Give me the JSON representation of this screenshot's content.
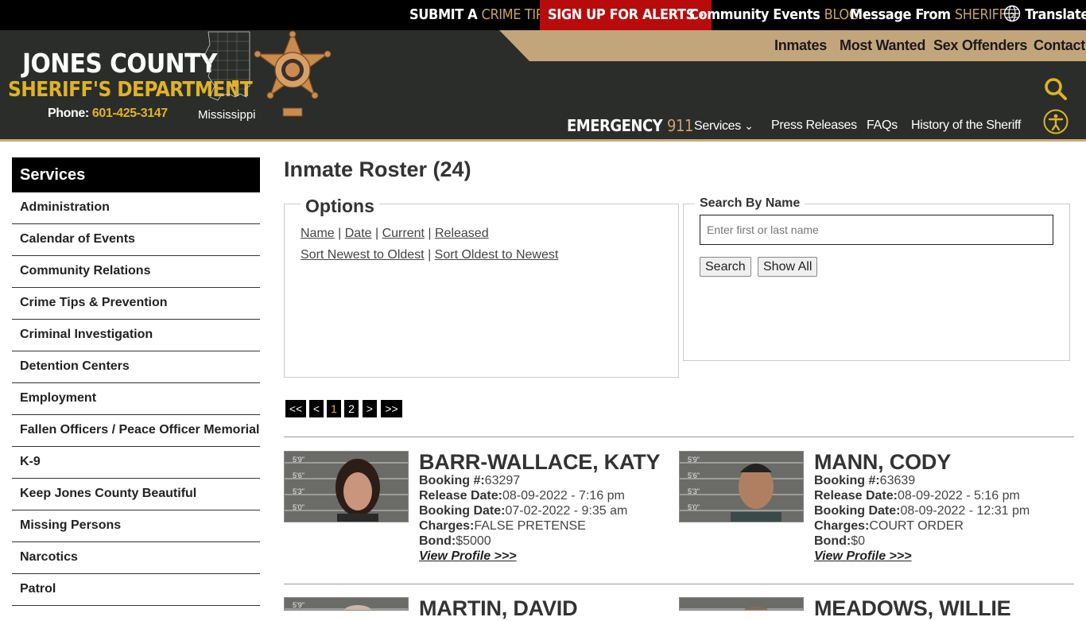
{
  "topbar": {
    "crime_tip": {
      "pre": "SUBMIT A ",
      "hl": "CRIME TIP",
      "chev": "›"
    },
    "alerts": {
      "label": "SIGN UP FOR ALERTS",
      "chev": "›"
    },
    "blog": {
      "pre": "Community Events ",
      "hl": "BLOG",
      "chev": "›"
    },
    "sheriff_msg": {
      "pre": "Message From ",
      "hl": "SHERIFF",
      "chev": "›"
    },
    "translate": "Translate"
  },
  "header": {
    "line1": "JONES COUNTY",
    "line2": "SHERIFF'S DEPARTMENT",
    "phone_label": "Phone: ",
    "phone": "601-425-3147",
    "state": "Mississippi",
    "util_links": [
      "Inmates",
      "Most Wanted",
      "Sex Offenders",
      "Contact"
    ],
    "emergency_label": "EMERGENCY",
    "emergency_num": "911",
    "nav": [
      "Services",
      "Press Releases",
      "FAQs",
      "History of the Sheriff"
    ],
    "nav_caret": "⌄"
  },
  "sidebar": {
    "title": "Services",
    "items": [
      "Administration",
      "Calendar of Events",
      "Community Relations",
      "Crime Tips & Prevention",
      "Criminal Investigation",
      "Detention Centers",
      "Employment",
      "Fallen Officers / Peace Officer Memorial",
      "K-9",
      "Keep Jones County Beautiful",
      "Missing Persons",
      "Narcotics",
      "Patrol"
    ]
  },
  "main": {
    "title": "Inmate Roster (24)",
    "options": {
      "legend": "Options",
      "sort_links": [
        "Name",
        "Date",
        "Current",
        "Released"
      ],
      "order_links": [
        "Sort Newest to Oldest",
        "Sort Oldest to Newest"
      ],
      "sep": " | "
    },
    "search": {
      "legend": "Search By Name",
      "placeholder": "Enter first or last name",
      "search_btn": "Search",
      "show_all_btn": "Show All"
    },
    "pager": [
      "<<",
      "<",
      "1",
      "2",
      ">",
      ">>"
    ],
    "current_page": "1"
  },
  "labels": {
    "booking_no": "Booking #:",
    "release_date": "Release Date:",
    "booking_date": "Booking Date:",
    "charges": "Charges:",
    "bond": "Bond:",
    "view_profile": "View Profile >>>"
  },
  "inmates": [
    {
      "name": "BARR-WALLACE, KATY",
      "booking_no": "63297",
      "release_date": "08-09-2022 - 7:16 pm",
      "booking_date": "07-02-2022 - 9:35 am",
      "charges": "FALSE PRETENSE",
      "bond": "$5000"
    },
    {
      "name": "MANN, CODY",
      "booking_no": "63639",
      "release_date": "08-09-2022 - 5:16 pm",
      "booking_date": "08-09-2022 - 12:31 pm",
      "charges": "COURT ORDER",
      "bond": "$0"
    },
    {
      "name": "MARTIN, DAVID"
    },
    {
      "name": "MEADOWS, WILLIE"
    }
  ],
  "height_marks": [
    "5'9\"",
    "5'6\"",
    "5'3\"",
    "5'0\""
  ],
  "colors": {
    "gold": "#e0b324",
    "tan": "#c3a57c",
    "alert_red": "#b80c0c",
    "header_bg": "#2a2d29"
  }
}
